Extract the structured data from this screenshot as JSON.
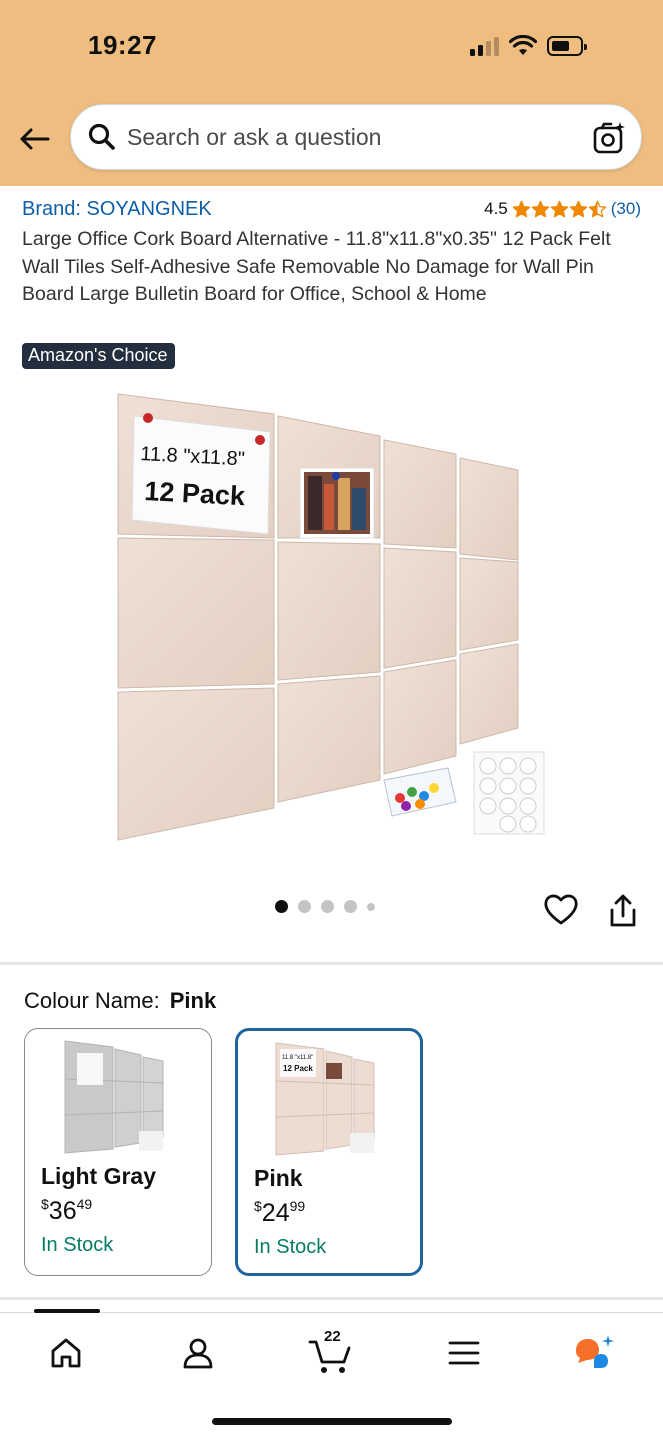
{
  "status_bar": {
    "time": "19:27"
  },
  "search": {
    "placeholder": "Search or ask a question"
  },
  "product": {
    "brand": "Brand: SOYANGNEK",
    "rating_value": "4.5",
    "rating_stars": 4.5,
    "review_count": "(30)",
    "title": "Large Office Cork Board Alternative - 11.8\"x11.8\"x0.35\" 12 Pack Felt Wall Tiles Self-Adhesive Safe Removable No Damage for Wall Pin Board Large Bulletin Board for Office, School & Home",
    "badge": "Amazon's Choice",
    "image_label_size": "11.8 \"x11.8\"",
    "image_label_pack": "12 Pack",
    "carousel_dots": 5,
    "carousel_active_index": 0
  },
  "colour": {
    "label": "Colour Name:",
    "selected": "Pink",
    "options": [
      {
        "name": "Light Gray",
        "price_symbol": "$",
        "price_whole": "36",
        "price_fraction": "49",
        "stock": "In Stock",
        "selected": false
      },
      {
        "name": "Pink",
        "price_symbol": "$",
        "price_whole": "24",
        "price_fraction": "99",
        "stock": "In Stock",
        "selected": true
      }
    ]
  },
  "nav": {
    "cart_count": "22"
  },
  "colors": {
    "header_bg": "#f0bd80",
    "link": "#0f5ea8",
    "star": "#f08804",
    "in_stock": "#067d62",
    "selected_border": "#2162a1",
    "badge_bg": "#232f3e",
    "ai_orange": "#f7702a",
    "ai_blue": "#1e88e5"
  },
  "icons": [
    "back-arrow-icon",
    "search-icon",
    "camera-icon",
    "star-icon",
    "heart-icon",
    "share-icon",
    "home-icon",
    "account-icon",
    "cart-icon",
    "menu-icon",
    "rufus-ai-icon"
  ]
}
